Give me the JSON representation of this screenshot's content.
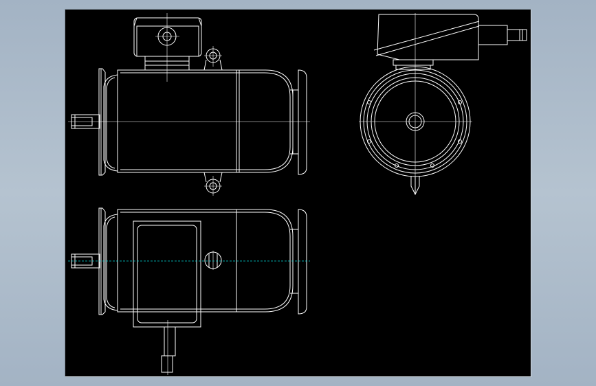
{
  "canvas": {
    "background_color": "#000000",
    "frame_color": "#a9b8c7",
    "line_color": "#ffffff",
    "centerline_color": "#00d8d8"
  },
  "views": [
    {
      "name": "front-view",
      "description_icon": "motor-side-elevation"
    },
    {
      "name": "end-view",
      "description_icon": "motor-end-elevation"
    },
    {
      "name": "top-view",
      "description_icon": "motor-plan-view"
    }
  ]
}
